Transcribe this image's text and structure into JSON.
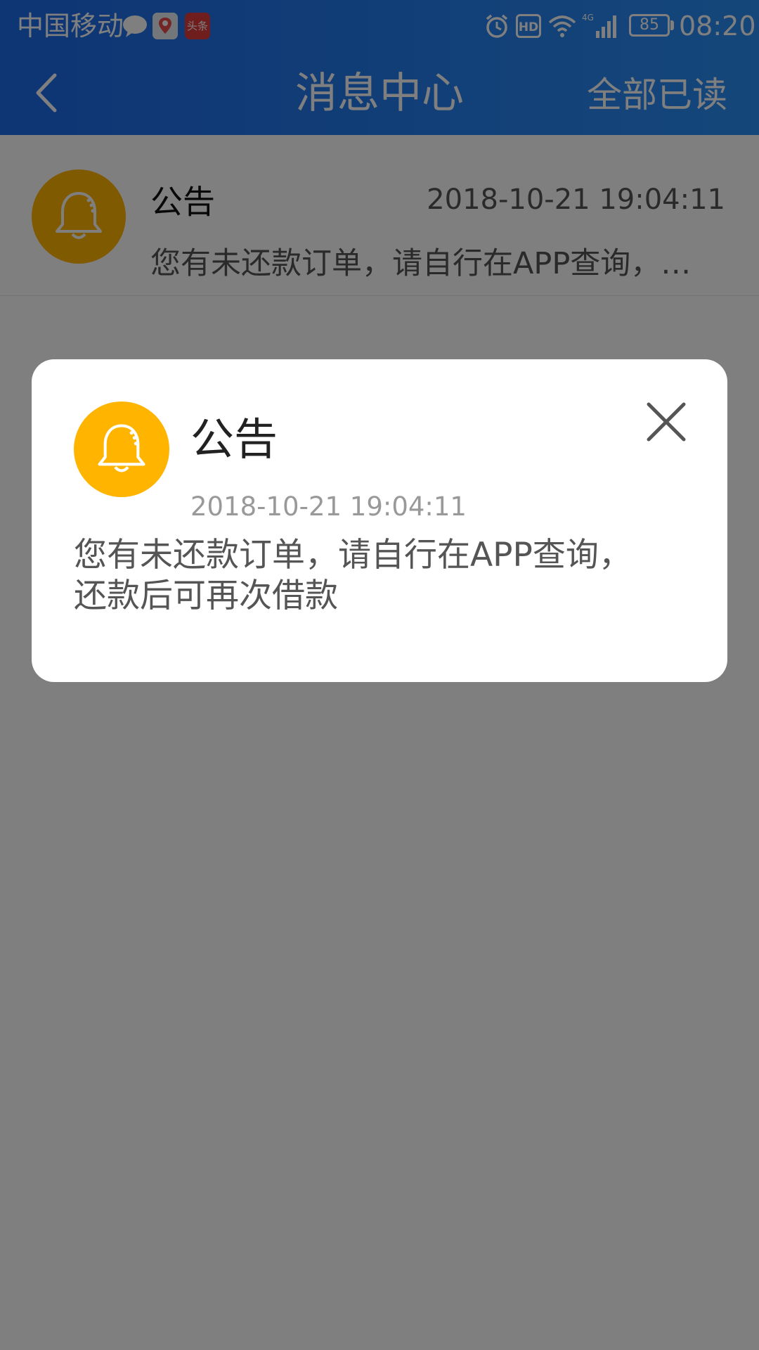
{
  "status_bar": {
    "carrier": "中国移动",
    "notification_badge": "头条",
    "network": "4G",
    "hd_label": "HD",
    "battery": "85",
    "time": "08:20"
  },
  "header": {
    "title": "消息中心",
    "mark_all_read": "全部已读"
  },
  "list": {
    "items": [
      {
        "title": "公告",
        "time": "2018-10-21 19:04:11",
        "preview": "您有未还款订单，请自行在APP查询，…"
      }
    ]
  },
  "dialog": {
    "title": "公告",
    "time": "2018-10-21 19:04:11",
    "body_line1": "您有未还款订单，请自行在APP查询，",
    "body_line2": "还款后可再次借款"
  },
  "colors": {
    "header_start": "#1d6ae8",
    "header_end": "#2a8ef5",
    "accent_bell": "#ffb400",
    "overlay": "rgba(0,0,0,0.5)"
  },
  "icons": {
    "back": "chevron-left-icon",
    "bell": "bell-icon",
    "close": "close-icon"
  }
}
